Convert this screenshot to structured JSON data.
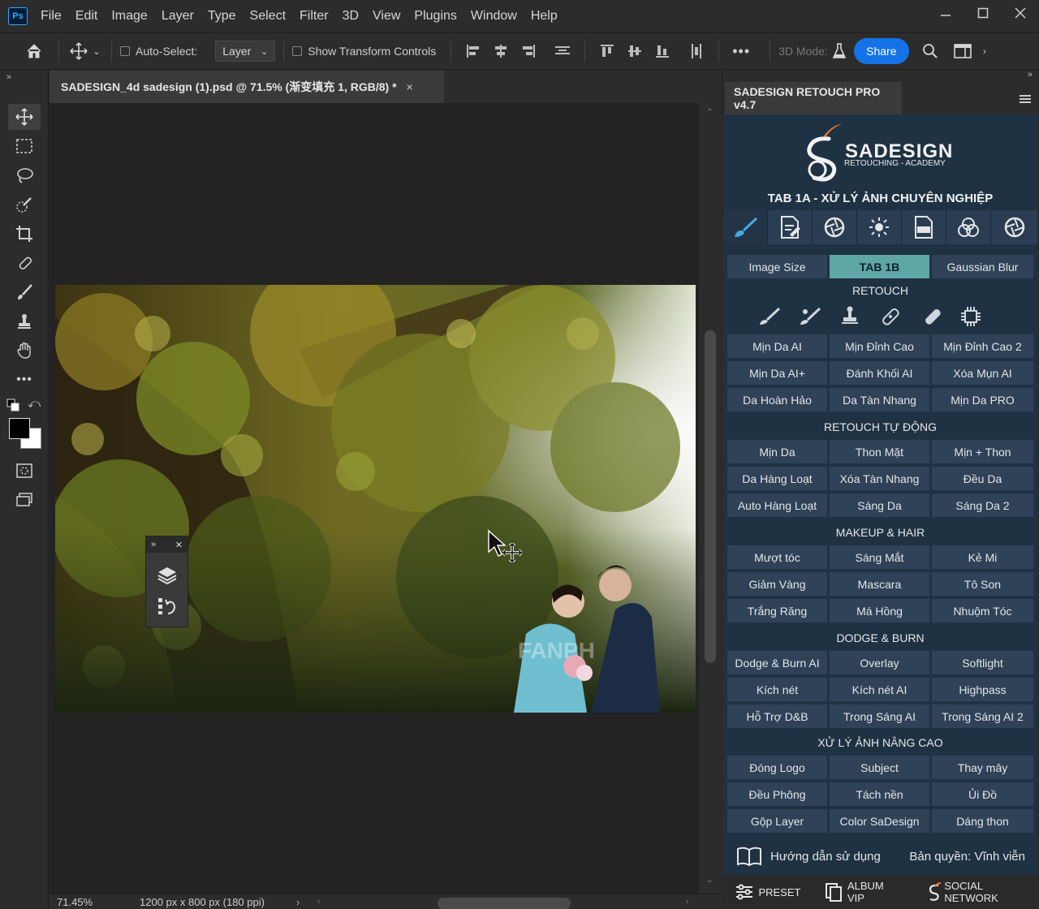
{
  "app": {
    "menu": [
      "File",
      "Edit",
      "Image",
      "Layer",
      "Type",
      "Select",
      "Filter",
      "3D",
      "View",
      "Plugins",
      "Window",
      "Help"
    ]
  },
  "options": {
    "auto_select_label": "Auto-Select:",
    "auto_select_value": "Layer",
    "show_transform_label": "Show Transform Controls",
    "more": "•••",
    "mode_3d": "3D Mode:",
    "share": "Share"
  },
  "document": {
    "tab_title": "SADESIGN_4d sadesign (1).psd @ 71.5% (渐变填充 1, RGB/8) *",
    "close": "×",
    "zoom": "71.45%",
    "size_info": "1200 px x 800 px (180 ppi)",
    "watermark": "FANPH"
  },
  "plugin": {
    "panel_title": "SADESIGN RETOUCH PRO v4.7",
    "brand_name": "SADESIGN",
    "brand_sub": "RETOUCHING - ACADEMY",
    "tab_title": "TAB 1A - XỬ LÝ ẢNH CHUYÊN NGHIỆP",
    "top_buttons": [
      "Image Size",
      "TAB 1B",
      "Gaussian Blur"
    ],
    "sections": {
      "retouch": "RETOUCH",
      "auto": "RETOUCH TỰ ĐỘNG",
      "makeup": "MAKEUP & HAIR",
      "dodge": "DODGE & BURN",
      "advanced": "XỬ LÝ ẢNH NÂNG CAO"
    },
    "retouch_buttons": [
      "Mịn Da AI",
      "Mịn Đỉnh Cao",
      "Mịn Đỉnh Cao 2",
      "Mịn Da AI+",
      "Đánh Khối AI",
      "Xóa Mụn AI",
      "Da Hoàn Hảo",
      "Da Tàn Nhang",
      "Mịn Da PRO"
    ],
    "auto_buttons": [
      "Mịn Da",
      "Thon Mặt",
      "Mịn + Thon",
      "Da Hàng Loạt",
      "Xóa Tàn Nhang",
      "Đều Da",
      "Auto Hàng Loạt",
      "Sáng Da",
      "Sáng Da 2"
    ],
    "makeup_buttons": [
      "Mượt tóc",
      "Sáng Mắt",
      "Kẻ Mi",
      "Giảm Vàng",
      "Mascara",
      "Tô Son",
      "Trắng Răng",
      "Má Hồng",
      "Nhuộm Tóc"
    ],
    "dodge_buttons": [
      "Dodge & Burn AI",
      "Overlay",
      "Softlight",
      "Kích nét",
      "Kích nét AI",
      "Highpass",
      "Hỗ Trợ D&B",
      "Trong Sáng AI",
      "Trong Sáng AI 2"
    ],
    "advanced_buttons": [
      "Đóng Logo",
      "Subject",
      "Thay mây",
      "Đều Phông",
      "Tách nền",
      "Ủi Đồ",
      "Gộp Layer",
      "Color SaDesign",
      "Dáng thon"
    ],
    "guide": "Hướng dẫn sử dụng",
    "license": "Bản quyền: Vĩnh viễn",
    "footer": [
      "PRESET",
      "ALBUM VIP",
      "SOCIAL NETWORK"
    ]
  },
  "colors": {
    "accent": "#1473e6",
    "plugin_bg": "#1f3244",
    "plugin_btn": "#2f4257",
    "plugin_highlight": "#5fa6a6",
    "brand_orange": "#e8782a"
  }
}
